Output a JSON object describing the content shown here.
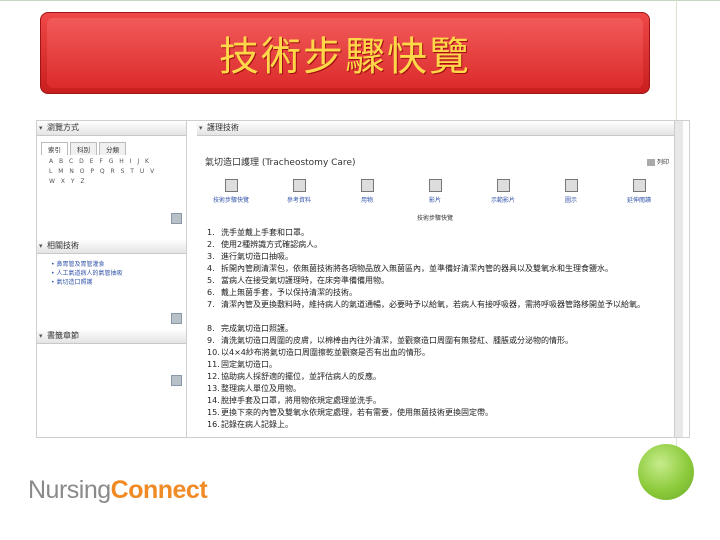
{
  "slide": {
    "title": "技術步驟快覽"
  },
  "left": {
    "browse_title": "瀏覽方式",
    "tabs": [
      "索引",
      "科別",
      "分類"
    ],
    "alphabet": "A B C D E F G H I J K L M N O P Q R S T U V W X Y Z",
    "related_title": "相關技術",
    "related_links": [
      "鼻胃管及胃管灌食",
      "人工氣道病人的氣管抽吸",
      "氣切造口照護"
    ],
    "bookmark_title": "書籤章節"
  },
  "main": {
    "panel_title": "護理技術",
    "doc_title": "氣切造口護理 (Tracheostomy Care)",
    "print_label": "列印",
    "toolbar": [
      "技術步驟快覽",
      "參考資料",
      "用物",
      "影片",
      "示範影片",
      "圖示",
      "延伸閱讀"
    ],
    "section_label": "技術步驟快覽",
    "steps": [
      "洗手並戴上手套和口罩。",
      "使用2種辨識方式確認病人。",
      "進行氣切造口抽吸。",
      "拆開內管刷清潔包，依無菌技術將各項物品放入無菌區內，並準備好清潔內管的器具以及雙氧水和生理食鹽水。",
      "當病人在接受氣切護理時，在床旁準備備用物。",
      "戴上無菌手套，予以保持清潔的技術。",
      "清潔內管及更換敷料時，維持病人的氣道通暢，必要時予以給氧，若病人有接呼吸器，需將呼吸器管路移開並予以給氧。",
      "完成氣切造口照護。",
      "清洗氣切造口周圍的皮膚，以棉棒由內往外清潔，並觀察造口周圍有無發紅、腫脹或分泌物的情形。",
      "以4×4紗布將氣切造口周圍擦乾並觀察是否有出血的情形。",
      "固定氣切造口。",
      "協助病人採舒適的擺位，並評估病人的反應。",
      "整理病人單位及用物。",
      "脫掉手套及口罩，將用物依規定處理並洗手。",
      "更換下來的內管及雙氧水依規定處理，若有需要，使用無菌技術更換固定帶。",
      "記錄在病人記錄上。"
    ]
  },
  "logo": {
    "part1": "Nursing",
    "part2": "Connect"
  }
}
